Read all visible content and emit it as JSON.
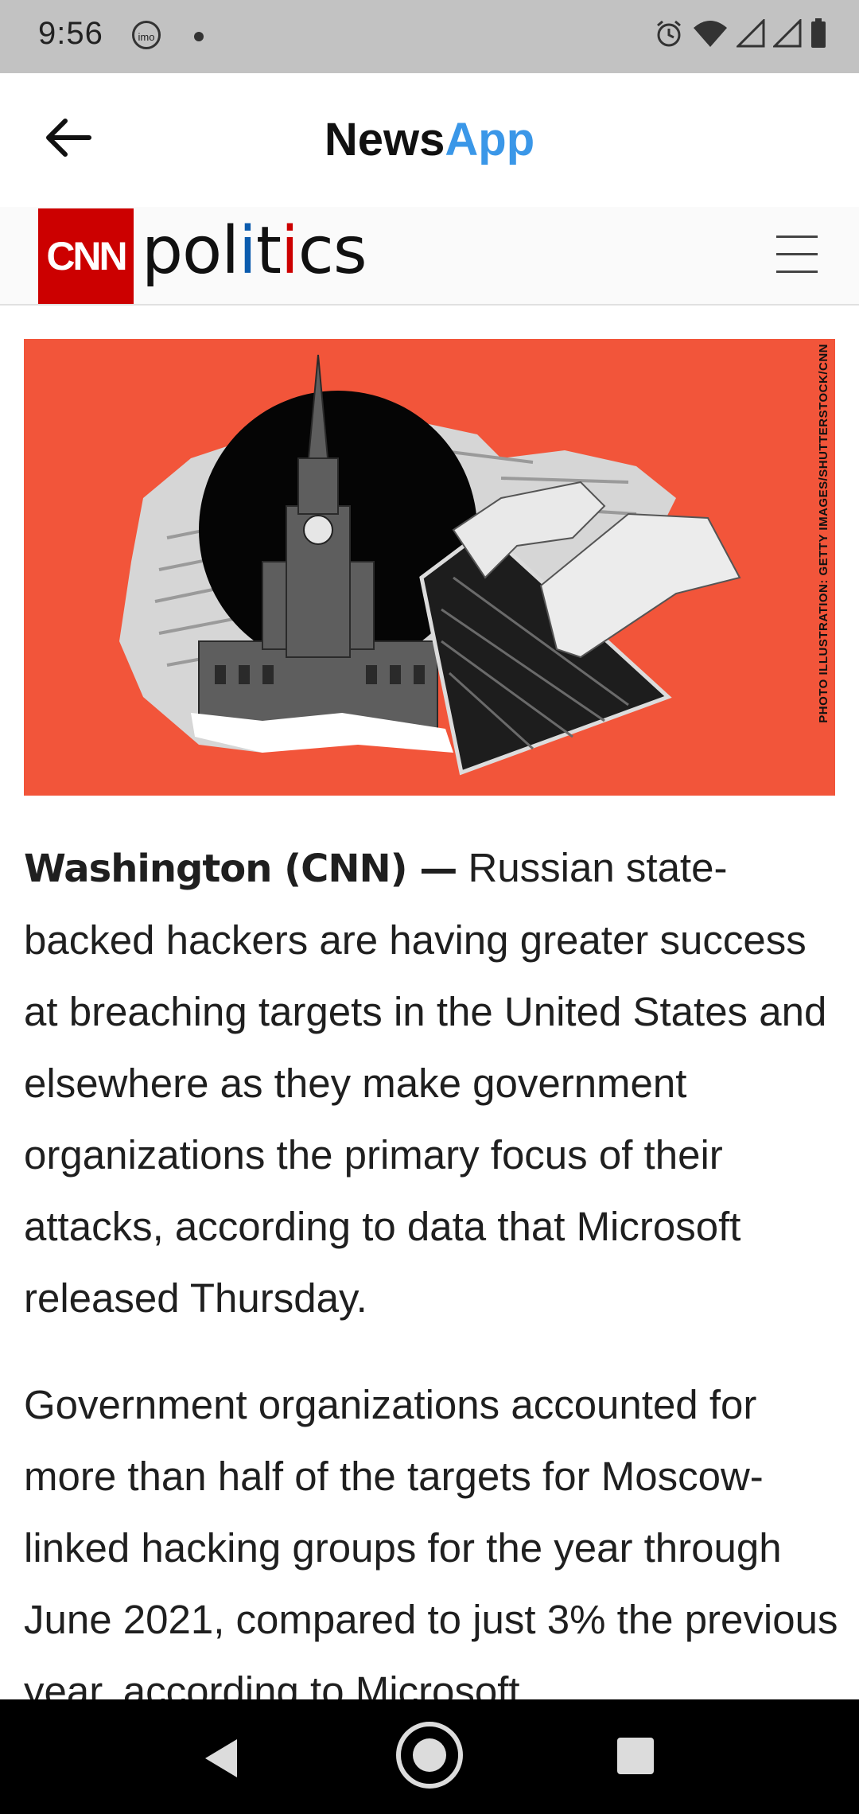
{
  "status_bar": {
    "time": "9:56",
    "notification_icon": "imo",
    "icons": [
      "alarm-icon",
      "wifi-icon",
      "signal-icon",
      "signal-icon",
      "battery-icon"
    ]
  },
  "app_bar": {
    "title_part1": "News",
    "title_part2": "App",
    "title_part2_color": "#3a97e8"
  },
  "cnn_header": {
    "logo_text": "CNN",
    "section_p1": "pol",
    "section_i1": "i",
    "section_p2": "t",
    "section_i2": "i",
    "section_p3": "cs",
    "brand_color": "#cc0000"
  },
  "hero": {
    "credit": "PHOTO ILLUSTRATION: GETTY IMAGES/SHUTTERSTOCK/CNN",
    "background_color": "#f2553a"
  },
  "article": {
    "dateline": "Washington (CNN) —",
    "p1_body": " Russian state-backed hackers are having greater success at breaching targets in the United States and elsewhere as they make government organizations the primary focus of their attacks, according to data that Microsoft released Thursday.",
    "p2": "Government organizations accounted for more than half of the targets for Moscow-linked hacking groups for the year through June 2021, compared to just 3% the previous year, according to Microsoft"
  },
  "nav_bar": {
    "buttons": [
      "back-icon",
      "home-icon",
      "recents-icon"
    ]
  }
}
